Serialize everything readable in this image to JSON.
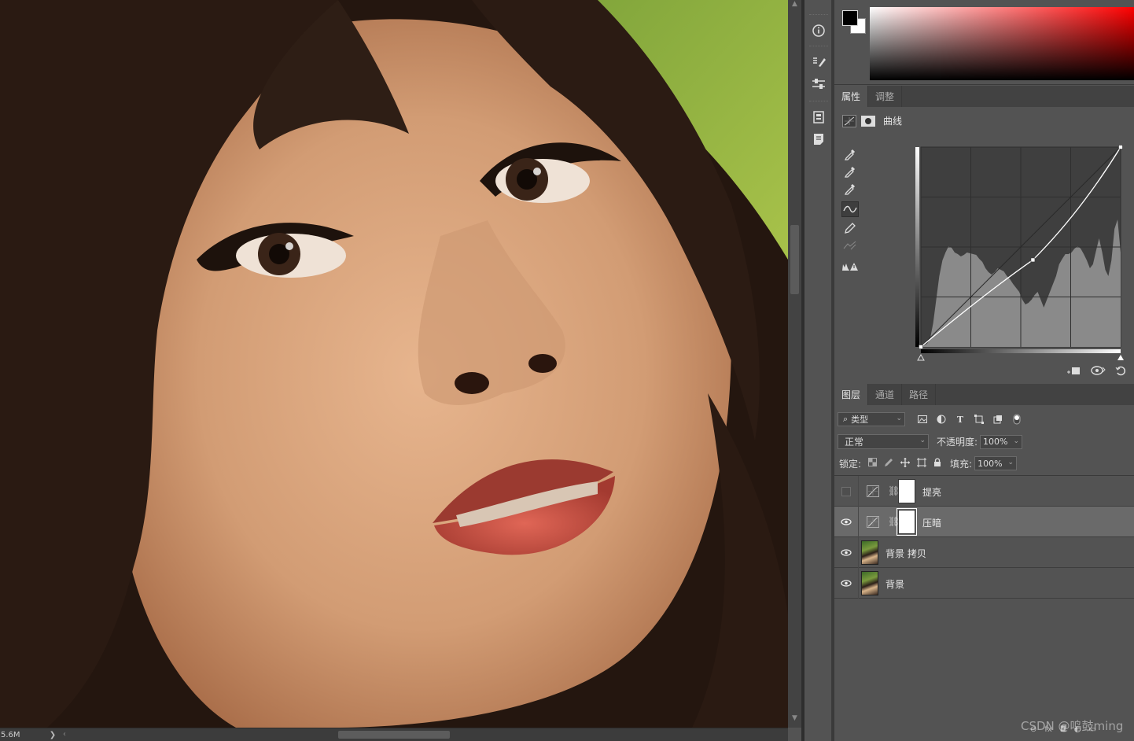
{
  "canvas": {
    "doc_size_text": "5.6M",
    "status_next": "❯",
    "status_prev": "‹"
  },
  "properties": {
    "tabs": [
      "属性",
      "调整"
    ],
    "active_tab": 0,
    "adjustment_name": "曲线"
  },
  "curves": {
    "input_range": [
      0,
      255
    ],
    "output_range": [
      0,
      255
    ],
    "control_points": [
      {
        "input": 0,
        "output": 0
      },
      {
        "input": 143,
        "output": 111
      },
      {
        "input": 255,
        "output": 255
      }
    ],
    "grid_divisions": 4,
    "histogram_color": "#8a8a8a",
    "curve_color": "#ffffff"
  },
  "layers": {
    "tabs": [
      "图层",
      "通道",
      "路径"
    ],
    "active_tab": 0,
    "filter_kind": "类型",
    "blend_mode": "正常",
    "opacity_label": "不透明度:",
    "opacity_value": "100%",
    "lock_label": "锁定:",
    "fill_label": "填充:",
    "fill_value": "100%",
    "items": [
      {
        "name": "提亮",
        "type": "curves-adjustment",
        "visible": false,
        "selected": false
      },
      {
        "name": "压暗",
        "type": "curves-adjustment",
        "visible": true,
        "selected": true
      },
      {
        "name": "背景 拷贝",
        "type": "pixel",
        "visible": true,
        "selected": false
      },
      {
        "name": "背景",
        "type": "pixel",
        "visible": true,
        "selected": false
      }
    ]
  },
  "colors": {
    "foreground": "#000000",
    "background": "#ffffff",
    "picker_hue": "#ff0000",
    "panel_bg": "#535353",
    "selected_row": "#6a6a6a"
  },
  "watermark": "CSDN @鸣鼓ming"
}
